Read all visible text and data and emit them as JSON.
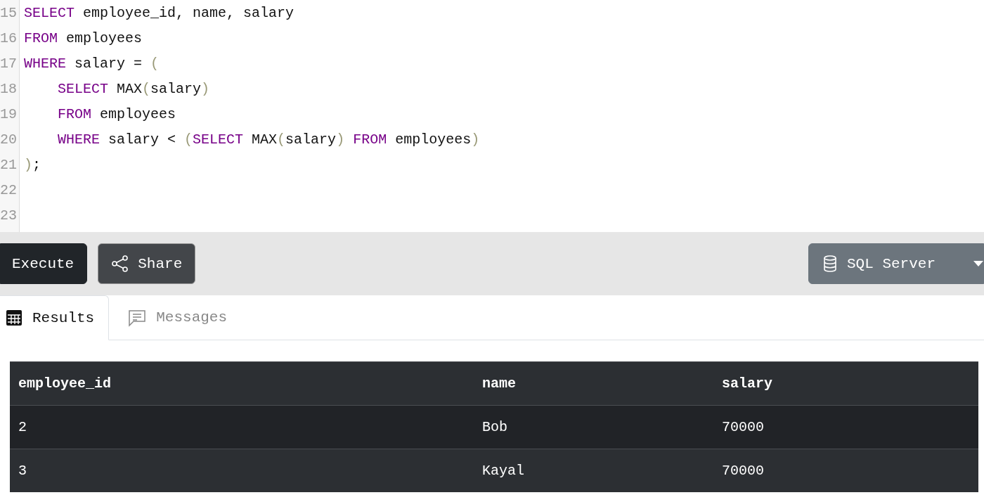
{
  "editor": {
    "lines": [
      {
        "number": "15",
        "tokens": [
          {
            "kind": "keyword",
            "text": "SELECT"
          },
          {
            "kind": "plain",
            "text": " employee_id, name, salary"
          }
        ]
      },
      {
        "number": "16",
        "tokens": [
          {
            "kind": "keyword",
            "text": "FROM"
          },
          {
            "kind": "plain",
            "text": " employees"
          }
        ]
      },
      {
        "number": "17",
        "tokens": [
          {
            "kind": "keyword",
            "text": "WHERE"
          },
          {
            "kind": "plain",
            "text": " salary = "
          },
          {
            "kind": "paren",
            "text": "("
          }
        ]
      },
      {
        "number": "18",
        "indented": true,
        "tokens": [
          {
            "kind": "keyword",
            "text": "SELECT"
          },
          {
            "kind": "plain",
            "text": " MAX"
          },
          {
            "kind": "paren",
            "text": "("
          },
          {
            "kind": "plain",
            "text": "salary"
          },
          {
            "kind": "paren",
            "text": ")"
          }
        ]
      },
      {
        "number": "19",
        "indented": true,
        "tokens": [
          {
            "kind": "keyword",
            "text": "FROM"
          },
          {
            "kind": "plain",
            "text": " employees"
          }
        ]
      },
      {
        "number": "20",
        "indented": true,
        "tokens": [
          {
            "kind": "keyword",
            "text": "WHERE"
          },
          {
            "kind": "plain",
            "text": " salary < "
          },
          {
            "kind": "paren",
            "text": "("
          },
          {
            "kind": "keyword",
            "text": "SELECT"
          },
          {
            "kind": "plain",
            "text": " MAX"
          },
          {
            "kind": "paren",
            "text": "("
          },
          {
            "kind": "plain",
            "text": "salary"
          },
          {
            "kind": "paren",
            "text": ")"
          },
          {
            "kind": "keyword",
            "text": "FROM",
            "space_before": true
          },
          {
            "kind": "plain",
            "text": " employees"
          },
          {
            "kind": "paren",
            "text": ")"
          }
        ]
      },
      {
        "number": "21",
        "tokens": [
          {
            "kind": "paren",
            "text": ")"
          },
          {
            "kind": "plain",
            "text": ";"
          }
        ]
      },
      {
        "number": "22"
      },
      {
        "number": "23"
      }
    ]
  },
  "toolbar": {
    "execute": "Execute",
    "share": "Share",
    "database": "SQL Server"
  },
  "tabs": [
    {
      "label": "Results",
      "kind": "table",
      "selected": true
    },
    {
      "label": "Messages",
      "kind": "messages",
      "selected": false
    }
  ],
  "table": {
    "columns": [
      "employee_id",
      "name",
      "salary"
    ],
    "rows": [
      [
        "2",
        "Bob",
        "70000"
      ],
      [
        "3",
        "Kayal",
        "70000"
      ]
    ]
  }
}
